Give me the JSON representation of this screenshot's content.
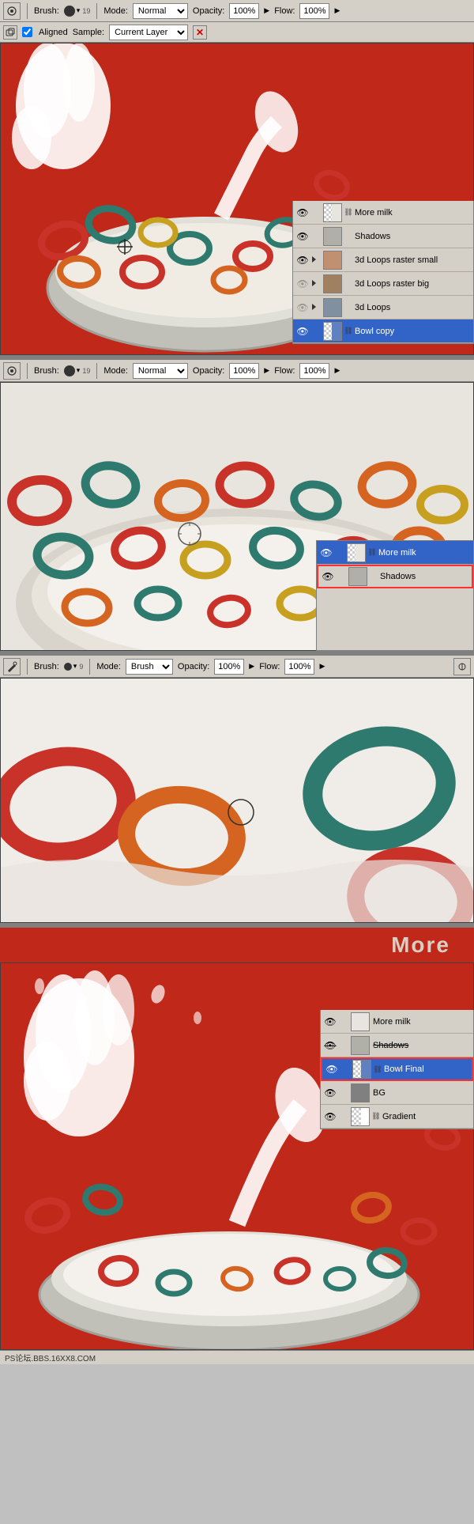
{
  "toolbar1": {
    "tool_label": "Brush:",
    "brush_size": "19",
    "mode_label": "Mode:",
    "mode_value": "Normal",
    "opacity_label": "Opacity:",
    "opacity_value": "100%",
    "flow_label": "Flow:",
    "flow_value": "100%"
  },
  "toolbar1b": {
    "aligned_label": "Aligned",
    "sample_label": "Sample:",
    "sample_value": "Current Layer"
  },
  "toolbar2": {
    "tool_label": "Brush:",
    "brush_size": "19",
    "mode_label": "Mode:",
    "mode_value": "Normal",
    "opacity_label": "Opacity:",
    "opacity_value": "100%",
    "flow_label": "Flow:",
    "flow_value": "100%"
  },
  "toolbar3": {
    "tool_label": "Brush:",
    "brush_size": "9",
    "mode_label": "Mode:",
    "mode_value": "Brush",
    "opacity_label": "Opacity:",
    "opacity_value": "100%",
    "flow_label": "Flow:",
    "flow_value": "100%"
  },
  "layers1": {
    "items": [
      {
        "name": "More milk",
        "visible": true,
        "has_arrow": false,
        "active": false,
        "thumb_color": "#e8e4e0",
        "has_mask": true
      },
      {
        "name": "Shadows",
        "visible": true,
        "has_arrow": false,
        "active": false,
        "thumb_color": "#b0b0a8",
        "has_mask": false
      },
      {
        "name": "3d Loops raster small",
        "visible": true,
        "has_arrow": true,
        "active": false,
        "thumb_color": "#c09070",
        "has_mask": false
      },
      {
        "name": "3d Loops raster big",
        "visible": false,
        "has_arrow": true,
        "active": false,
        "thumb_color": "#a08060",
        "has_mask": false
      },
      {
        "name": "3d Loops",
        "visible": false,
        "has_arrow": true,
        "active": false,
        "thumb_color": "#8090a0",
        "has_mask": false
      },
      {
        "name": "Bowl copy",
        "visible": true,
        "has_arrow": false,
        "active": true,
        "thumb_color": "#6080c0",
        "has_mask": true
      }
    ]
  },
  "layers2": {
    "items": [
      {
        "name": "More milk",
        "visible": true,
        "has_arrow": false,
        "active": true,
        "thumb_color": "#e8e4e0",
        "has_mask": true
      },
      {
        "name": "Shadows",
        "visible": true,
        "has_arrow": false,
        "active": false,
        "thumb_color": "#b0b0a8",
        "has_mask": false
      }
    ]
  },
  "layers3": {
    "items": [
      {
        "name": "More milk",
        "visible": true,
        "has_arrow": false,
        "active": false,
        "thumb_color": "#e8e4e0",
        "has_mask": true
      },
      {
        "name": "Shadows",
        "visible": true,
        "has_arrow": false,
        "active": false,
        "thumb_color": "#b0b0a8",
        "has_mask": false
      },
      {
        "name": "Bowl Final",
        "visible": true,
        "has_arrow": false,
        "active": true,
        "thumb_color": "#6080c0",
        "has_mask": true
      },
      {
        "name": "BG",
        "visible": true,
        "has_arrow": false,
        "active": false,
        "thumb_color": "#808080",
        "has_mask": false
      },
      {
        "name": "Gradient",
        "visible": true,
        "has_arrow": false,
        "active": false,
        "thumb_color": "#c02020",
        "has_mask": true
      }
    ]
  },
  "more_text": "More",
  "watermark": "PS论坛.BBS.16XX8.COM",
  "colors": {
    "red_bg": "#c0281a",
    "toolbar_bg": "#d4d0c8",
    "active_layer": "#3264c8",
    "canvas_bg": "#808080"
  }
}
